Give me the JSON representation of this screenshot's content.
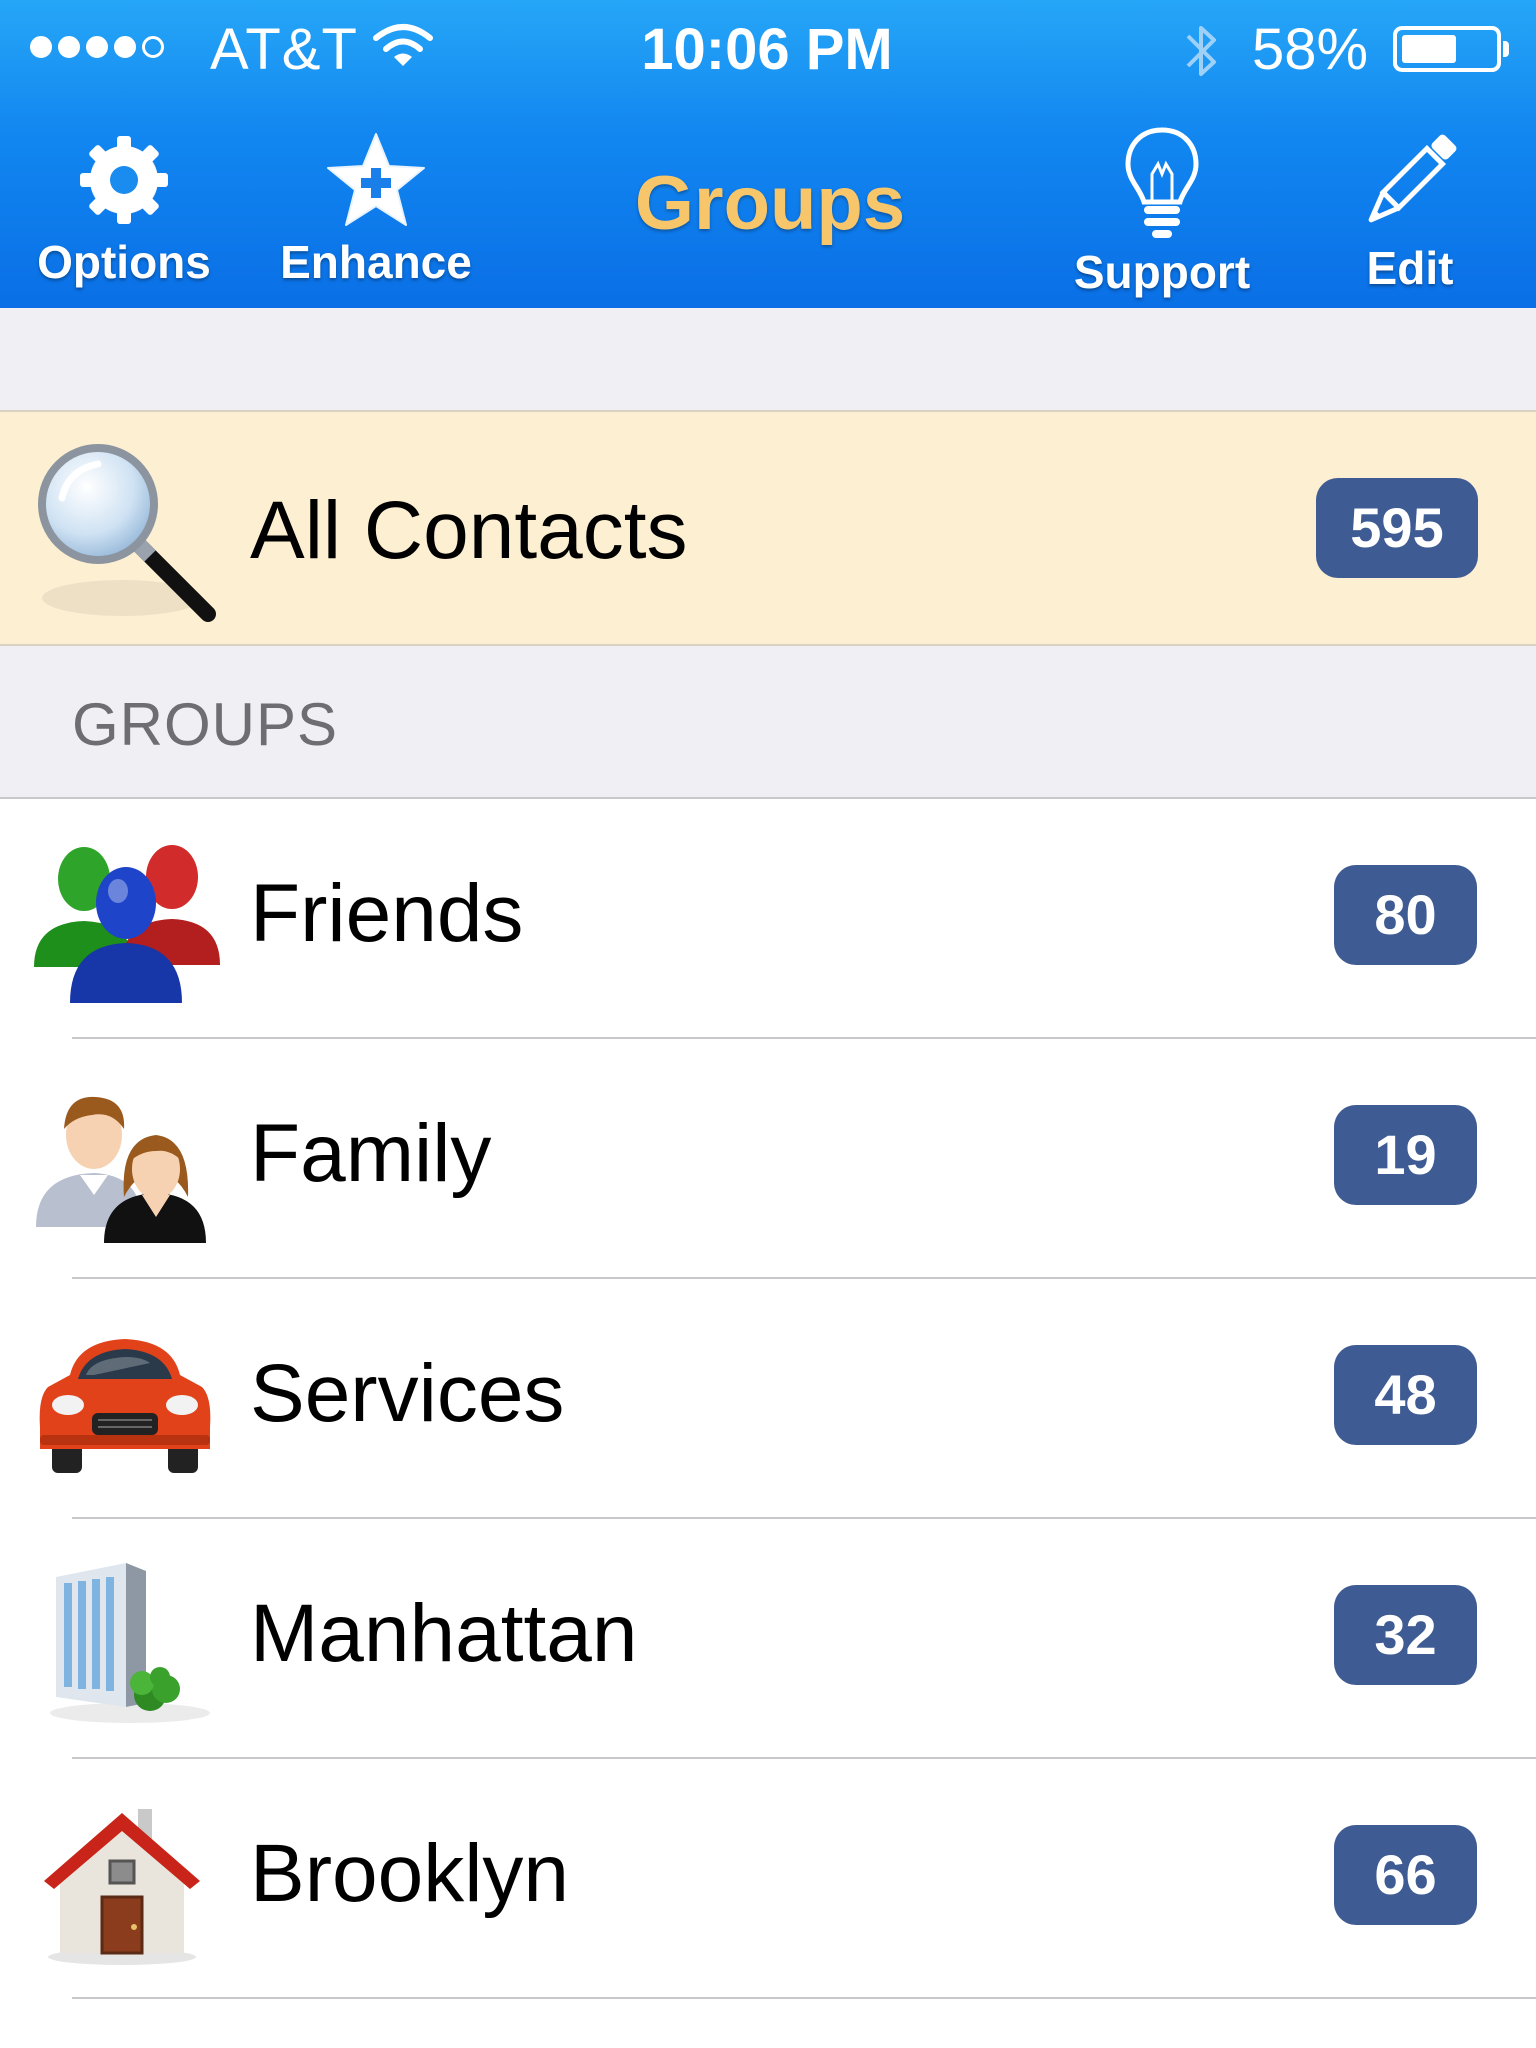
{
  "status_bar": {
    "carrier": "AT&T",
    "time": "10:06 PM",
    "battery_percent_text": "58%",
    "battery_level": 0.58,
    "signal_bars_filled": 4,
    "signal_bars_total": 5
  },
  "nav": {
    "title": "Groups",
    "options_label": "Options",
    "enhance_label": "Enhance",
    "support_label": "Support",
    "edit_label": "Edit",
    "title_color": "#f7c66a"
  },
  "all_contacts": {
    "label": "All Contacts",
    "count": "595",
    "icon": "magnifier-icon"
  },
  "groups_section": {
    "header": "GROUPS",
    "items": [
      {
        "label": "Friends",
        "count": "80",
        "icon": "friends-group-icon"
      },
      {
        "label": "Family",
        "count": "19",
        "icon": "family-icon"
      },
      {
        "label": "Services",
        "count": "48",
        "icon": "car-icon"
      },
      {
        "label": "Manhattan",
        "count": "32",
        "icon": "building-icon"
      },
      {
        "label": "Brooklyn",
        "count": "66",
        "icon": "house-icon"
      }
    ]
  },
  "colors": {
    "nav_blue": "#1186f0",
    "badge": "#3e5b93",
    "highlight_row": "#fdefd2"
  }
}
